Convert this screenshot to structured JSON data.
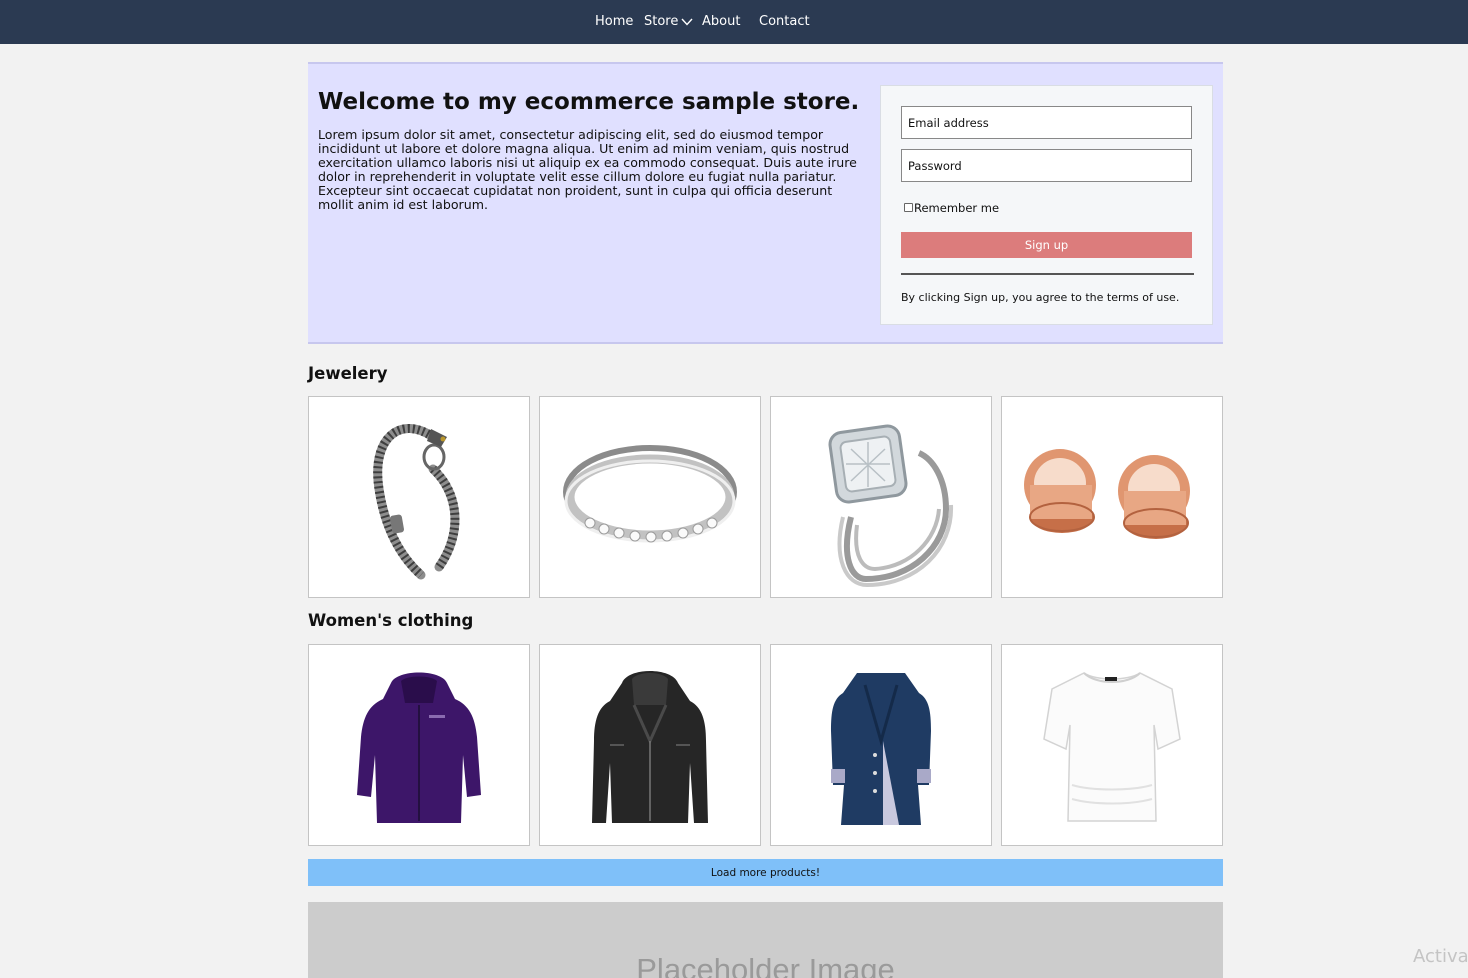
{
  "nav": {
    "items": [
      {
        "label": "Home"
      },
      {
        "label": "Store"
      },
      {
        "label": "About"
      },
      {
        "label": "Contact"
      }
    ]
  },
  "hero": {
    "title": "Welcome to my ecommerce sample store.",
    "body": "Lorem ipsum dolor sit amet, consectetur adipiscing elit, sed do eiusmod tempor incididunt ut labore et dolore magna aliqua. Ut enim ad minim veniam, quis nostrud exercitation ullamco laboris nisi ut aliquip ex ea commodo consequat. Duis aute irure dolor in reprehenderit in voluptate velit esse cillum dolore eu fugiat nulla pariatur. Excepteur sint occaecat cupidatat non proident, sunt in culpa qui officia deserunt mollit anim id est laborum."
  },
  "signup": {
    "email_placeholder": "Email address",
    "password_placeholder": "Password",
    "remember_label": "Remember me",
    "remember_checked": false,
    "button_label": "Sign up",
    "terms": "By clicking Sign up, you agree to the terms of use.",
    "button_color": "#dc7c7c"
  },
  "sections": [
    {
      "title": "Jewelery",
      "products": [
        {
          "icon": "chain-bracelet-icon"
        },
        {
          "icon": "diamond-band-ring-icon"
        },
        {
          "icon": "engagement-ring-set-icon"
        },
        {
          "icon": "rose-gold-plugs-icon"
        }
      ]
    },
    {
      "title": "Women's clothing",
      "products": [
        {
          "icon": "purple-jacket-icon"
        },
        {
          "icon": "black-leather-jacket-icon"
        },
        {
          "icon": "navy-raincoat-icon"
        },
        {
          "icon": "white-tshirt-icon"
        }
      ]
    }
  ],
  "load_more_label": "Load more products!",
  "placeholder_label": "Placeholder Image",
  "os_watermark": "Activa",
  "colors": {
    "navbar": "#2b3a52",
    "hero_bg": "#e0e0ff",
    "load_more": "#7fc0f9"
  }
}
